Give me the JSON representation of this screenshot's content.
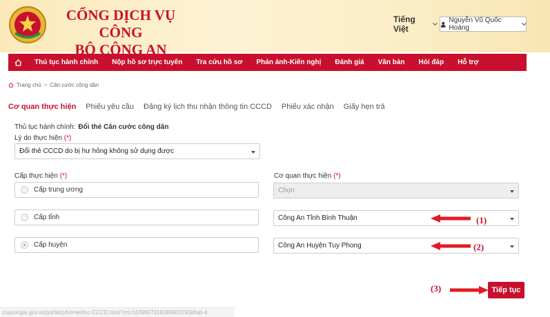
{
  "header": {
    "title_line1": "CỔNG DỊCH VỤ CÔNG",
    "title_line2": "BỘ CÔNG AN",
    "language": "Tiếng Việt",
    "user_name": "Nguyễn Vũ Quốc Hoàng",
    "brand_color": "#c8102e"
  },
  "nav": {
    "items": [
      "Thủ tục hành chính",
      "Nộp hồ sơ trực tuyến",
      "Tra cứu hồ sơ",
      "Phản ánh-Kiến nghị",
      "Đánh giá",
      "Văn bản",
      "Hỏi đáp",
      "Hỗ trợ"
    ]
  },
  "breadcrumb": {
    "home": "Trang chủ",
    "current": "Căn cước công dân"
  },
  "tabs": [
    "Cơ quan thực hiện",
    "Phiếu yêu cầu",
    "Đăng ký lịch thu nhận thông tin CCCD",
    "Phiếu xác nhận",
    "Giấy hẹn trả"
  ],
  "form": {
    "procedure_label": "Thủ tục hành chính:",
    "procedure_value": "Đổi thẻ Căn cước công dân",
    "reason_label": "Lý do thực hiện",
    "required_mark": "(*)",
    "reason_value": "Đổi thẻ CCCD do bị hư hỏng không sử dụng được",
    "level_label": "Cấp thực hiện",
    "levels": [
      "Cấp trung ương",
      "Cấp tỉnh",
      "Cấp huyện"
    ],
    "agency_label": "Cơ quan thực hiện",
    "agency_placeholder": "Chọn",
    "agency_province": "Công An Tỉnh Bình Thuận",
    "agency_district": "Công An Huyện Tuy Phong",
    "next_label": "Tiếp tục"
  },
  "annotations": [
    "(1)",
    "(2)",
    "(3)"
  ],
  "status_url": "cuquocgia.gov.vn/portal/p/home/dvc-CCCD.html?crt=1639667318349603190l#tab-4"
}
